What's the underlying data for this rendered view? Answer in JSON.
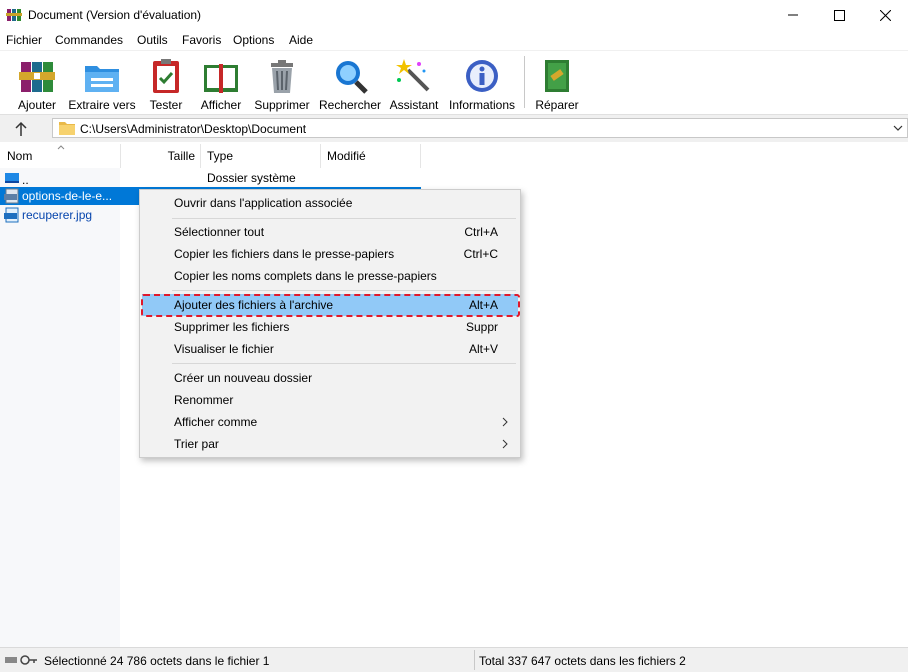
{
  "window": {
    "title": "Document (Version d'évaluation)"
  },
  "menu": [
    "Fichier",
    "Commandes",
    "Outils",
    "Favoris",
    "Options",
    "Aide"
  ],
  "toolbar": [
    {
      "label": "Ajouter",
      "icon": "add-books-icon"
    },
    {
      "label": "Extraire vers",
      "icon": "extract-folder-icon"
    },
    {
      "label": "Tester",
      "icon": "test-clipboard-icon"
    },
    {
      "label": "Afficher",
      "icon": "view-book-icon"
    },
    {
      "label": "Supprimer",
      "icon": "trash-icon"
    },
    {
      "label": "Rechercher",
      "icon": "magnifier-icon"
    },
    {
      "label": "Assistant",
      "icon": "wand-icon"
    },
    {
      "label": "Informations",
      "icon": "info-icon"
    },
    {
      "label": "Réparer",
      "icon": "repair-icon"
    }
  ],
  "address": {
    "path": "C:\\Users\\Administrator\\Desktop\\Document"
  },
  "columns": [
    "Nom",
    "Taille",
    "Type",
    "Modifié"
  ],
  "files": [
    {
      "name": "..",
      "type": "Dossier système"
    },
    {
      "name": "options-de-le-e...",
      "type": ""
    },
    {
      "name": "recuperer.jpg",
      "type": ""
    }
  ],
  "context_menu": [
    {
      "label": "Ouvrir dans l'application associée",
      "shortcut": ""
    },
    {
      "label": "Sélectionner tout",
      "shortcut": "Ctrl+A"
    },
    {
      "label": "Copier les fichiers dans le presse-papiers",
      "shortcut": "Ctrl+C"
    },
    {
      "label": "Copier les noms complets dans le presse-papiers",
      "shortcut": ""
    },
    {
      "label": "Ajouter des fichiers à l'archive",
      "shortcut": "Alt+A"
    },
    {
      "label": "Supprimer les fichiers",
      "shortcut": "Suppr"
    },
    {
      "label": "Visualiser le fichier",
      "shortcut": "Alt+V"
    },
    {
      "label": "Créer un nouveau dossier",
      "shortcut": ""
    },
    {
      "label": "Renommer",
      "shortcut": ""
    },
    {
      "label": "Afficher comme",
      "shortcut": "",
      "submenu": true
    },
    {
      "label": "Trier par",
      "shortcut": "",
      "submenu": true
    }
  ],
  "status": {
    "left": "Sélectionné 24 786 octets dans le fichier 1",
    "right": "Total 337 647 octets dans les fichiers 2"
  },
  "colors": {
    "selection": "#0078d7",
    "highlight": "#91c9f7",
    "outline": "#e0182b"
  }
}
